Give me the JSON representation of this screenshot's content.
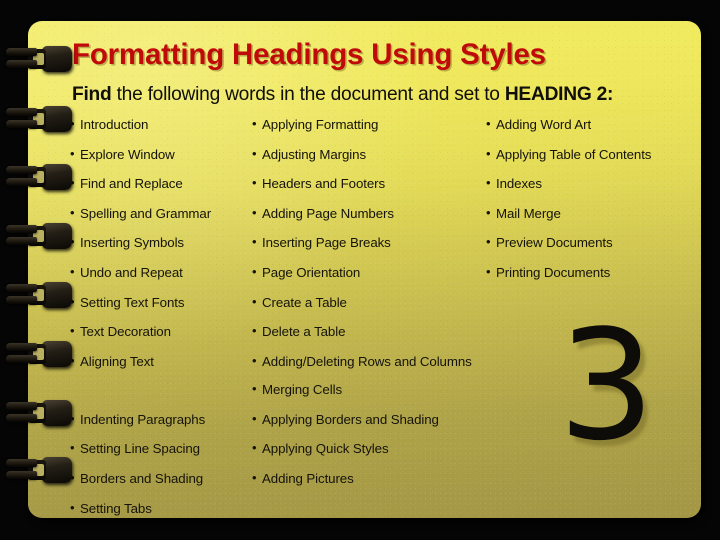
{
  "slide": {
    "title": "Formatting Headings Using Styles",
    "subtitle": {
      "lead": "Find",
      "middle": " the following words in the document and set to ",
      "emphasis": "HEADING 2:"
    },
    "slide_number": "3",
    "colors": {
      "title": "#C00A0A",
      "body_text": "#15130A",
      "paper_top": "#F2EC60",
      "paper_bottom": "#A39746",
      "background": "#000000",
      "ring": "#140F09"
    },
    "binder_rings": 8,
    "columns": [
      {
        "name": "column-1",
        "items": [
          "Introduction",
          "Explore Window",
          "Find and Replace",
          "Spelling and Grammar",
          "Inserting Symbols",
          "Undo and Repeat",
          "Setting Text Fonts",
          "Text Decoration",
          "Aligning Text",
          "Indenting Paragraphs",
          "Setting Line Spacing",
          "Borders and Shading",
          "Setting Tabs"
        ]
      },
      {
        "name": "column-2",
        "items": [
          "Applying Formatting",
          "Adjusting Margins",
          "Headers and Footers",
          "Adding Page Numbers",
          "Inserting Page Breaks",
          "Page Orientation",
          "Create a Table",
          "Delete a Table",
          "Adding/Deleting Rows and Columns",
          "Merging Cells",
          "Applying Borders and Shading",
          "Applying Quick Styles",
          "Adding Pictures"
        ]
      },
      {
        "name": "column-3",
        "items": [
          "Adding Word Art",
          "Applying Table of Contents",
          "Indexes",
          "Mail Merge",
          "Preview Documents",
          "Printing Documents"
        ]
      }
    ]
  }
}
